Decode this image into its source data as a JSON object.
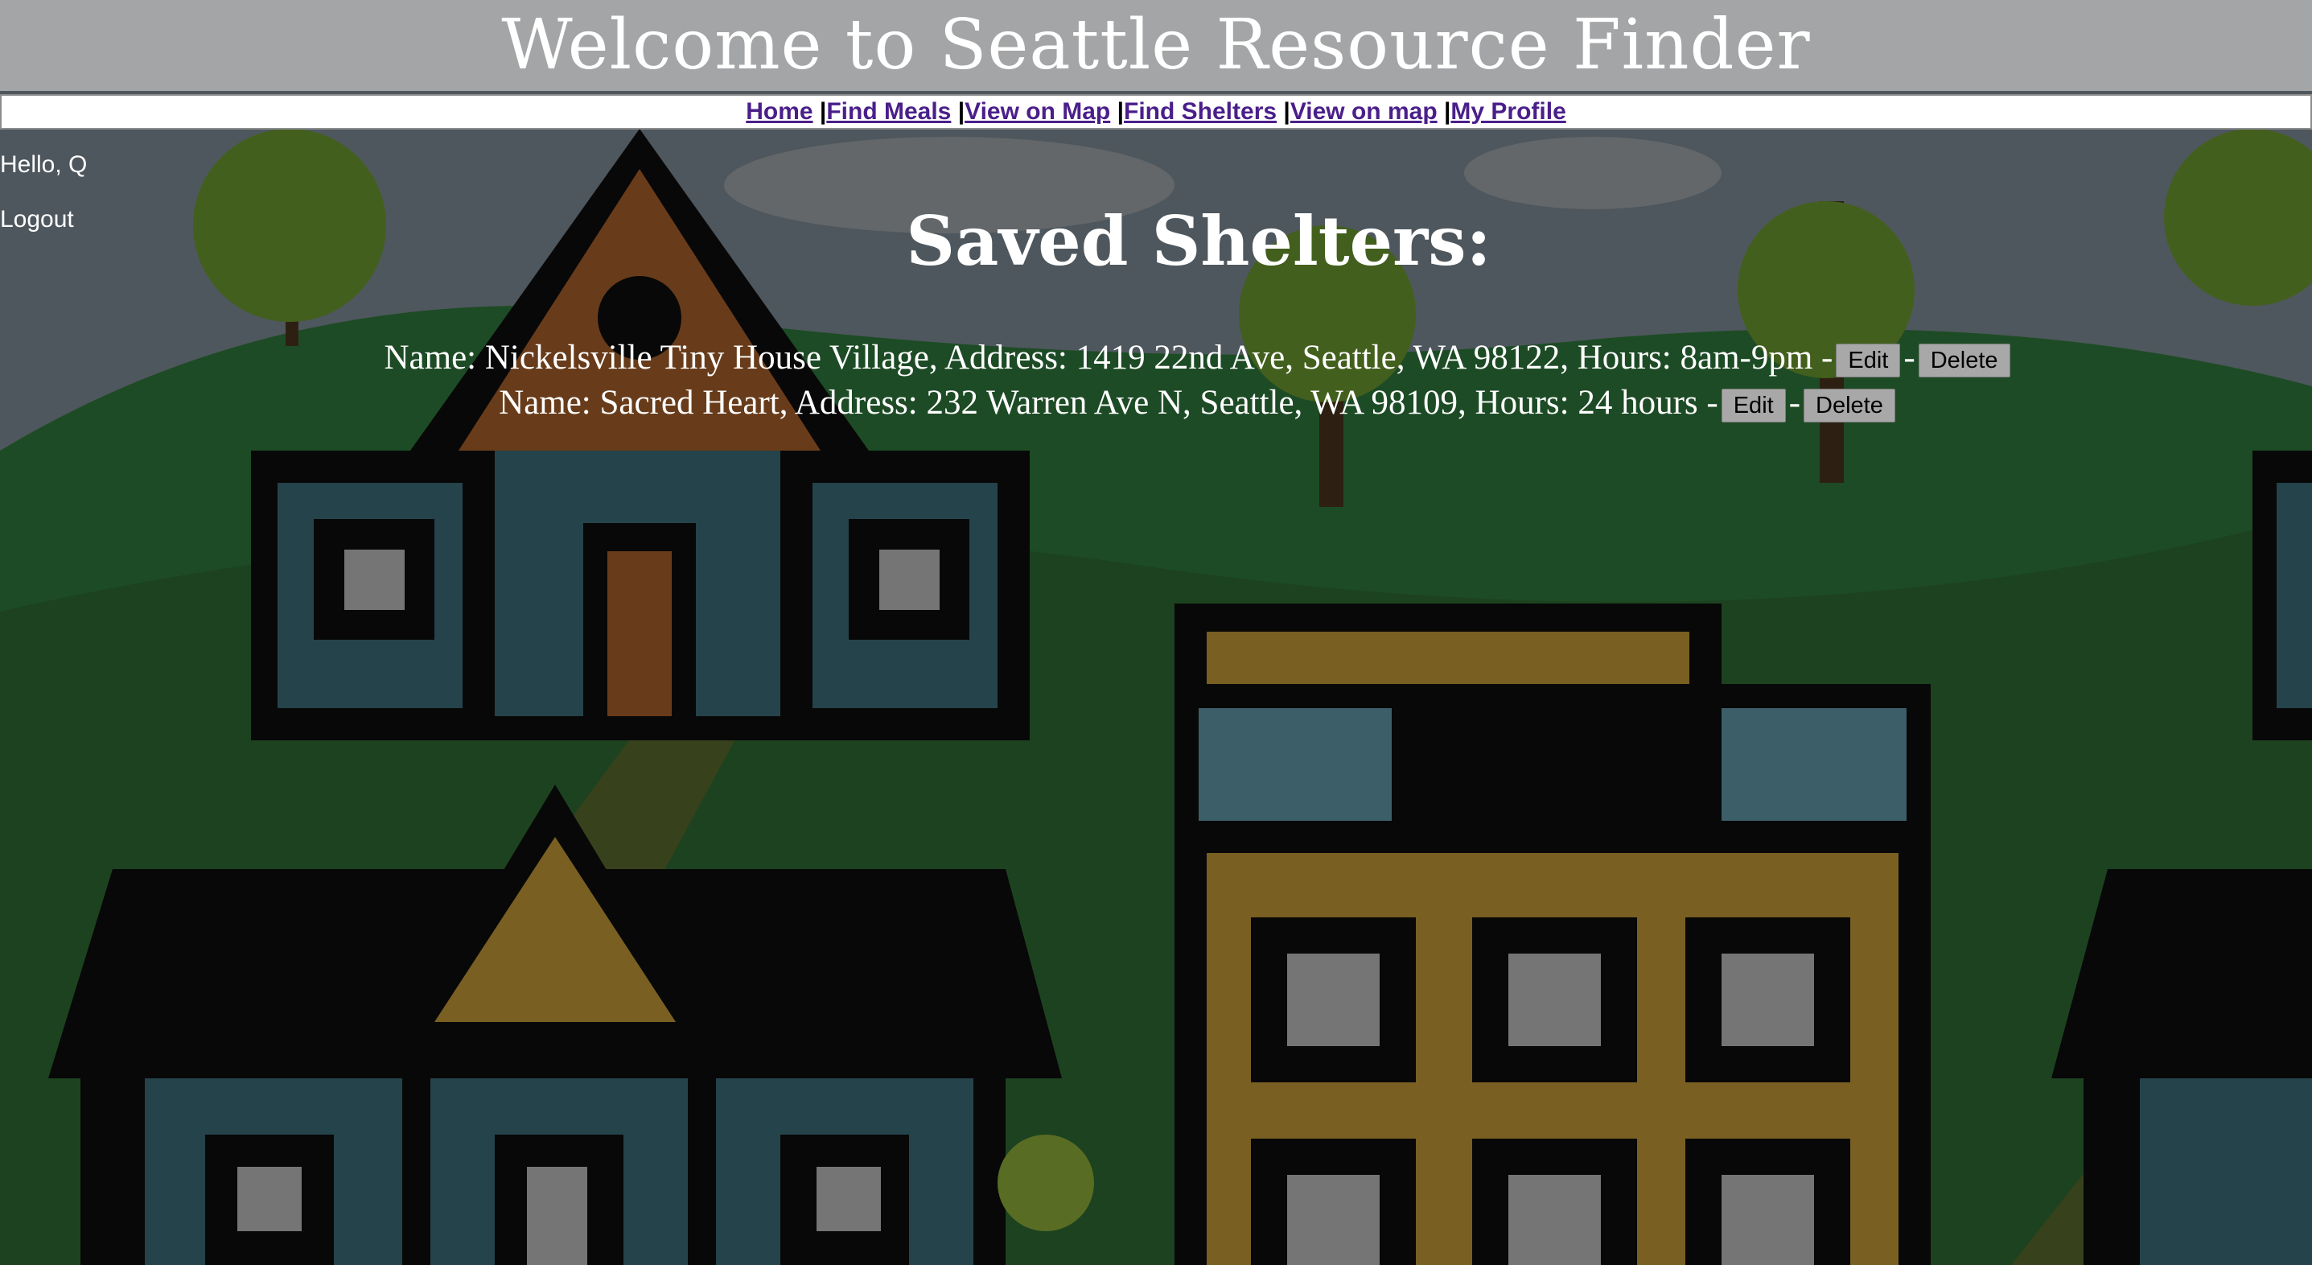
{
  "header": {
    "title": "Welcome to Seattle Resource Finder"
  },
  "nav": {
    "links": [
      "Home",
      "Find Meals",
      "View on Map",
      "Find Shelters",
      "View on map",
      "My Profile"
    ],
    "separator": "|"
  },
  "user": {
    "greeting": "Hello, Q",
    "logout": "Logout"
  },
  "main": {
    "heading": "Saved Shelters:",
    "shelters": [
      {
        "text": "Name: Nickelsville Tiny House Village, Address: 1419 22nd Ave, Seattle, WA 98122, Hours: 8am-9pm"
      },
      {
        "text": "Name: Sacred Heart, Address: 232 Warren Ave N, Seattle, WA 98109, Hours: 24 hours"
      }
    ],
    "dash": "-",
    "edit_label": "Edit",
    "delete_label": "Delete"
  },
  "colors": {
    "header_bg": "#a3a5a6",
    "link": "#4a1f8a",
    "button_bg": "#a8a8a8"
  }
}
